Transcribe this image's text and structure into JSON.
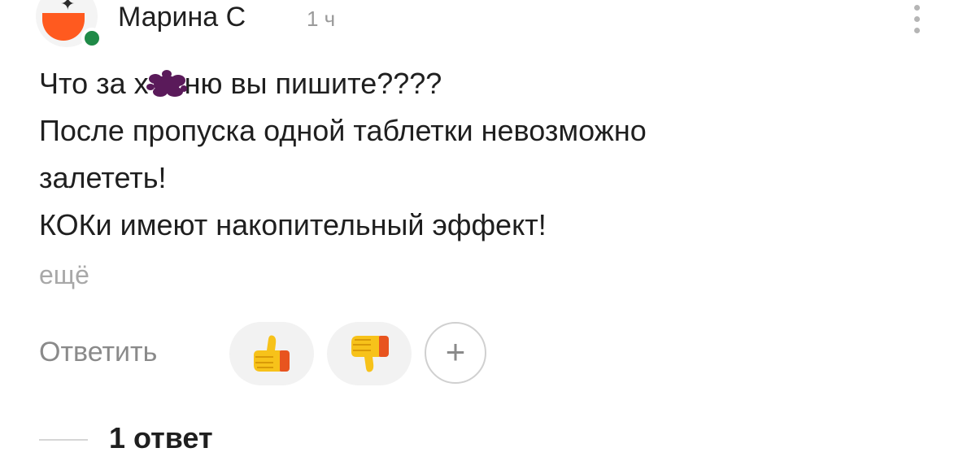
{
  "comment": {
    "author": "Марина С",
    "time": "1 ч",
    "line1_before": "Что за х",
    "line1_after": "ню вы пишите????",
    "line2": "После пропуска одной таблетки невозможно",
    "line3": "залететь!",
    "line4": "КОКи имеют накопительный эффект!",
    "more": "ещё"
  },
  "actions": {
    "reply": "Ответить",
    "like_icon": "thumbs-up-icon",
    "dislike_icon": "thumbs-down-icon",
    "add_icon": "plus-icon",
    "add_symbol": "+"
  },
  "replies": {
    "label": "1 ответ"
  },
  "colors": {
    "online": "#1f8a47",
    "avatar_accent": "#ff5a1f",
    "censor": "#5a1a5a",
    "muted_text": "#8a8a8a"
  }
}
